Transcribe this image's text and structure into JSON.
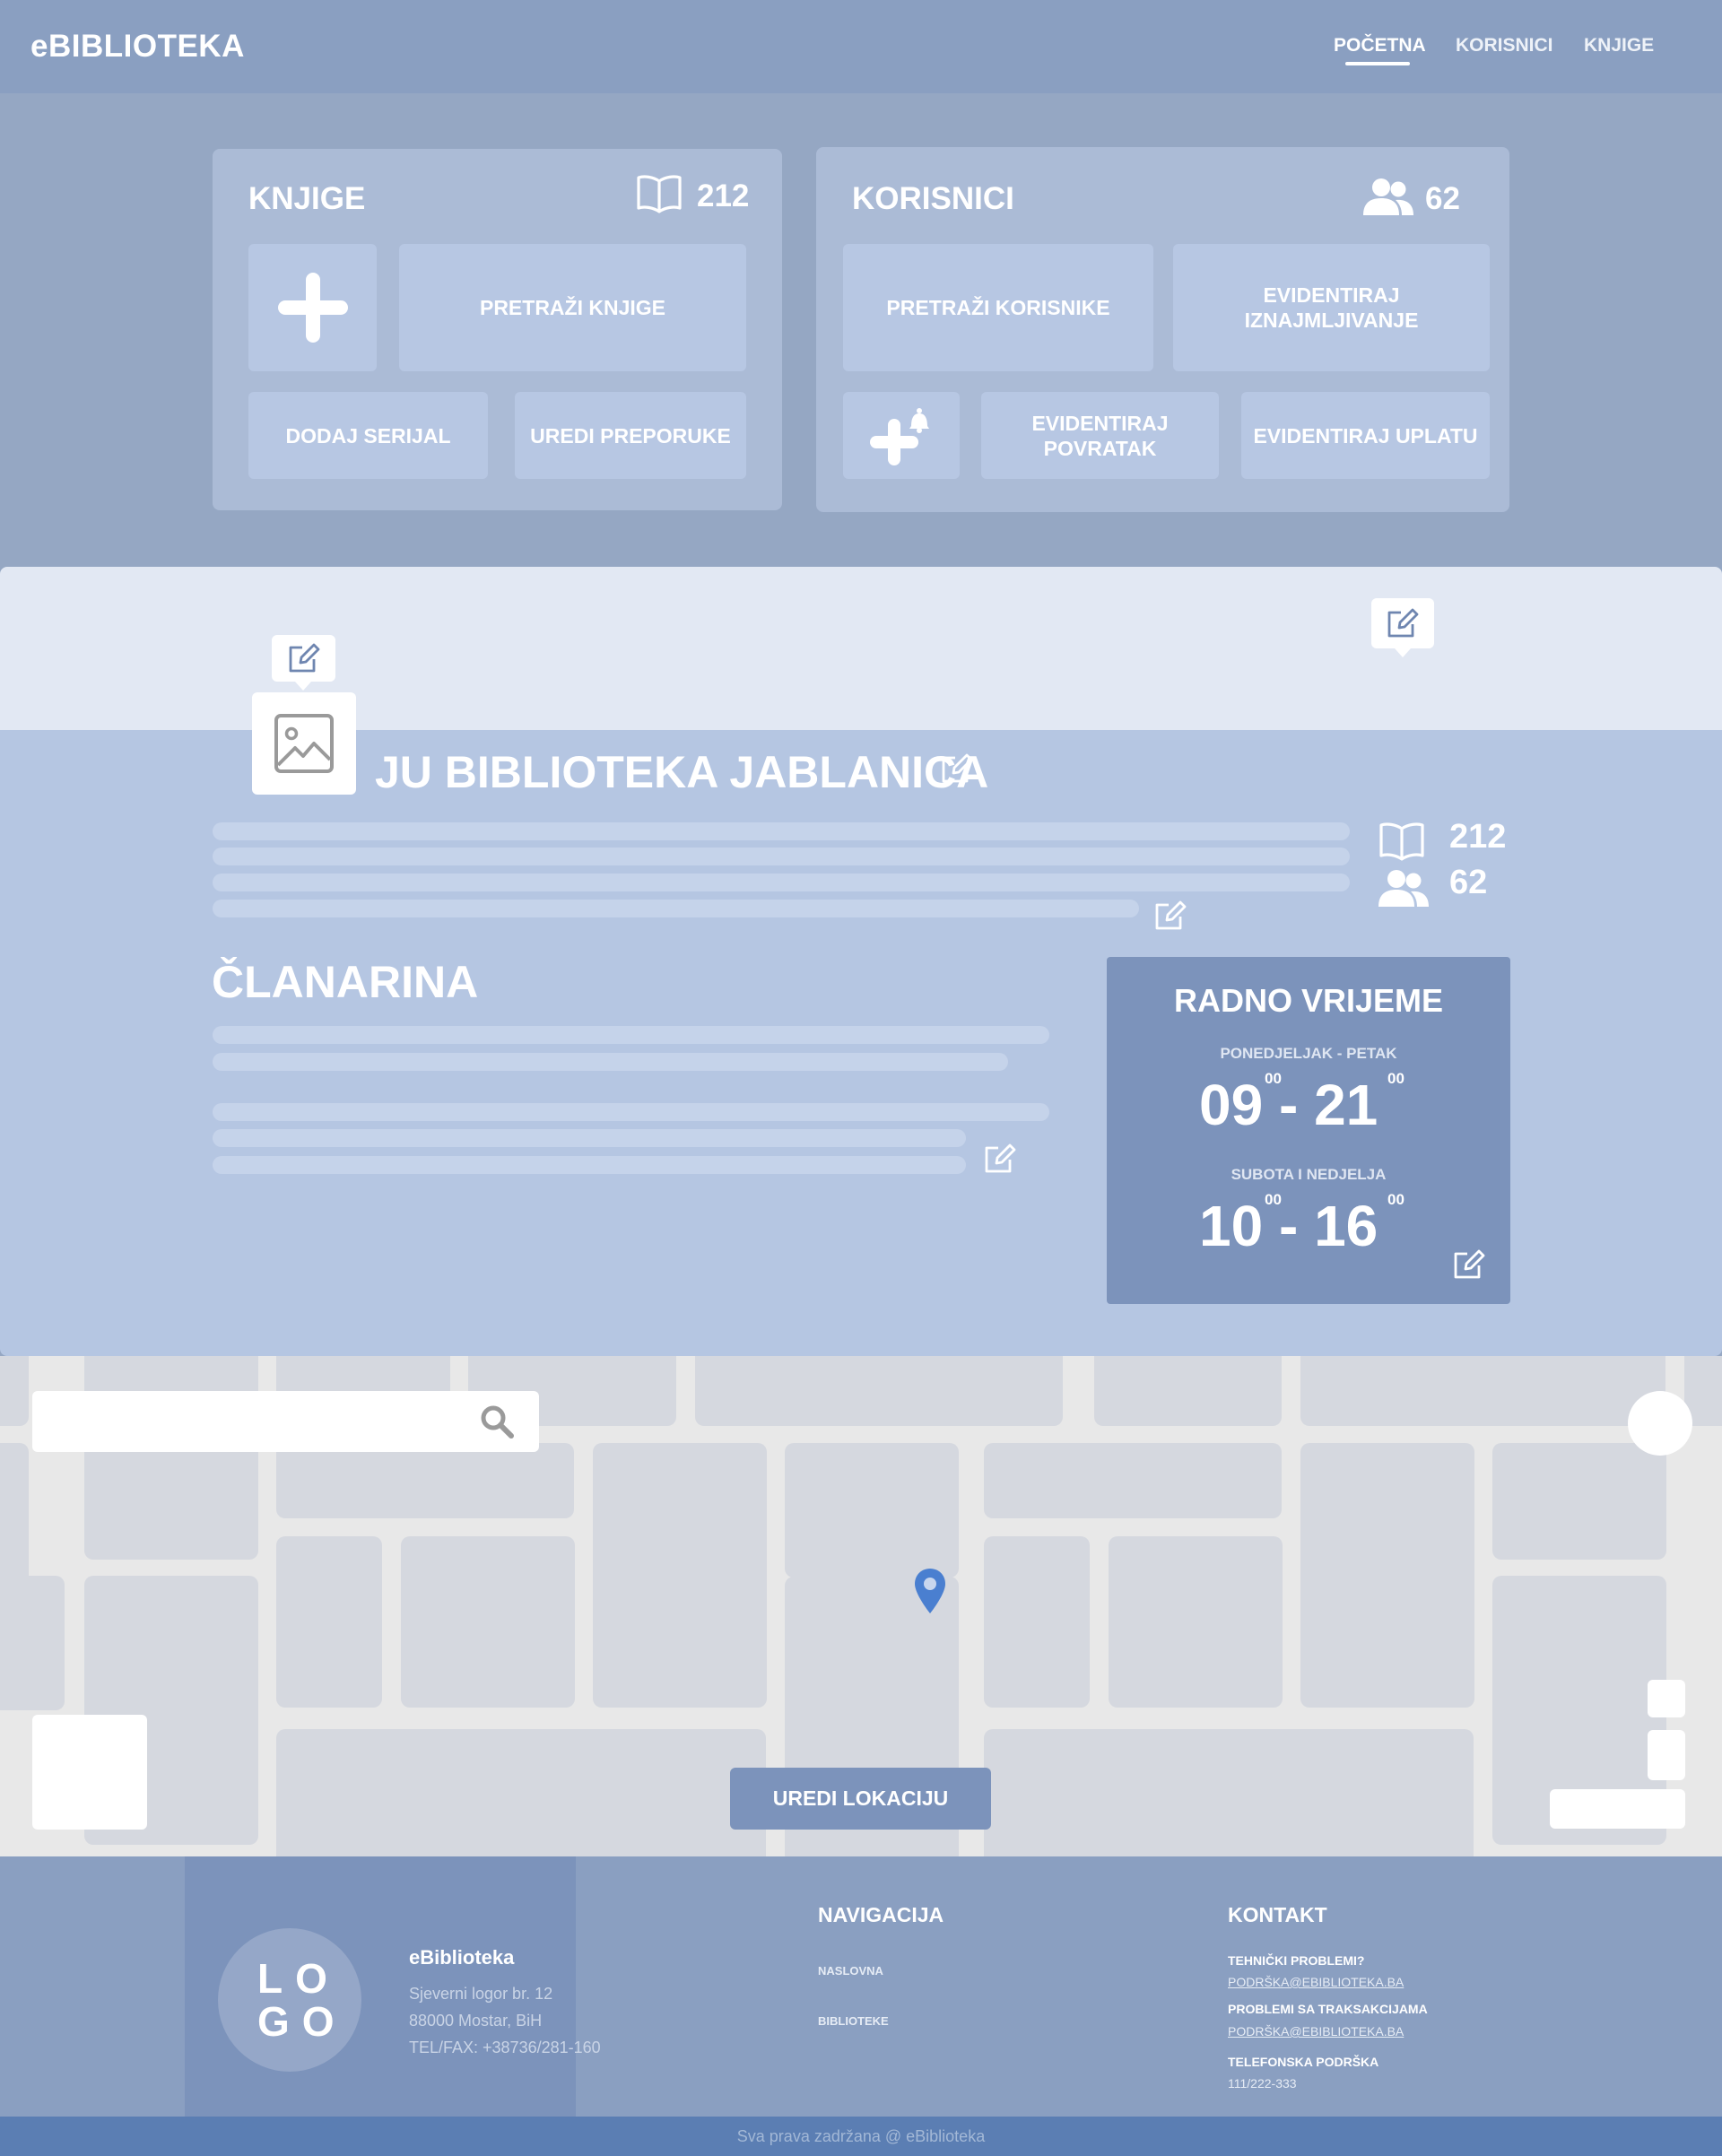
{
  "navbar": {
    "brand": "eBIBLIOTEKA",
    "links": [
      "POČETNA",
      "KORISNICI",
      "KNJIGE"
    ],
    "active": "POČETNA"
  },
  "books_panel": {
    "title": "KNJIGE",
    "count": "212",
    "search_label": "PRETRAŽI KNJIGE",
    "add_serial_label": "DODAJ SERIJAL",
    "edit_recommendations_label": "UREDI PREPORUKE"
  },
  "users_panel": {
    "title": "KORISNICI",
    "count": "62",
    "search_label": "PRETRAŽI KORISNIKE",
    "record_lending_label": "EVIDENTIRAJ IZNAJMLJIVANJE",
    "record_return_label": "EVIDENTIRAJ POVRATAK",
    "record_payment_label": "EVIDENTIRAJ UPLATU"
  },
  "library": {
    "name": "JU BIBLIOTEKA JABLANICA",
    "books_count": "212",
    "users_count": "62",
    "membership_title": "ČLANARINA"
  },
  "hours": {
    "title": "RADNO VRIJEME",
    "weekdays_label": "PONEDJELJAK - PETAK",
    "weekdays_time": "09 - 21",
    "weekdays_open_min": "00",
    "weekdays_close_min": "00",
    "weekend_label": "SUBOTA I NEDJELJA",
    "weekend_time": "10 - 16",
    "weekend_open_min": "00",
    "weekend_close_min": "00"
  },
  "map": {
    "edit_location_label": "UREDI LOKACIJU"
  },
  "footer": {
    "logo_text": "LO GO",
    "brand": "eBiblioteka",
    "address_line1": "Sjeverni logor br. 12",
    "address_line2": "88000 Mostar, BiH",
    "phone": "TEL/FAX: +38736/281-160",
    "nav_title": "NAVIGACIJA",
    "nav_links": [
      "NASLOVNA",
      "BIBLIOTEKE"
    ],
    "contact_title": "KONTAKT",
    "tech_label": "TEHNIČKI PROBLEMI?",
    "tech_email": "PODRŠKA@EBIBLIOTEKA.BA",
    "transactions_label": "PROBLEMI SA TRAKSAKCIJAMA",
    "transactions_email": "PODRŠKA@EBIBLIOTEKA.BA",
    "phone_label": "TELEFONSKA PODRŠKA",
    "phone_number": "111/222-333",
    "copyright": "Sva prava zadržana @ eBiblioteka"
  },
  "colors": {
    "navbar": "#8a9fc1",
    "page_bg": "#95a7c3",
    "panel": "#abbbd6",
    "tile": "#b7c7e3",
    "library_section": "#b5c6e2",
    "hours_card": "#7c93bb",
    "map_marker": "#4a7fd0",
    "copyright_bar": "#5b7eb3"
  }
}
